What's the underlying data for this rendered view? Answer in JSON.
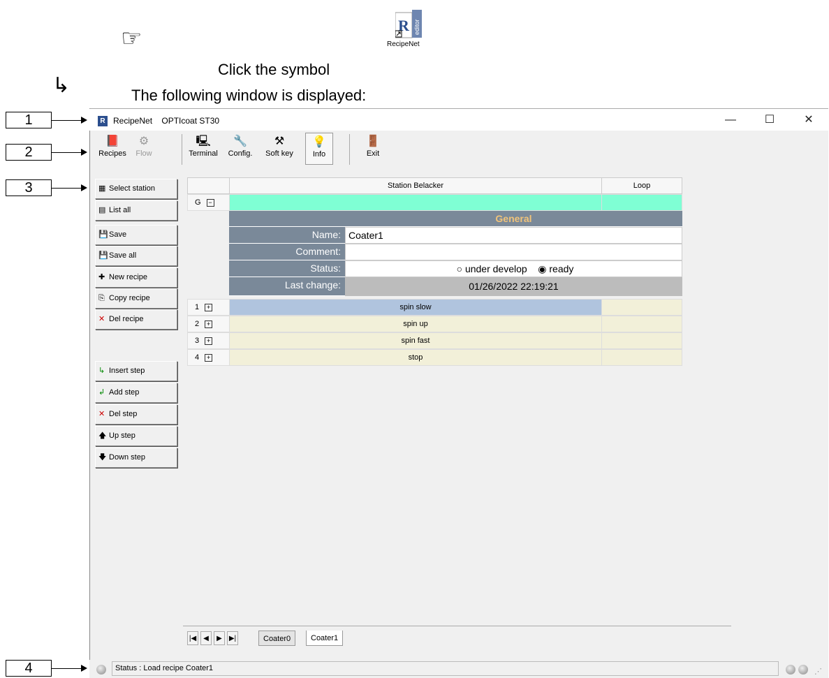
{
  "instructions": {
    "step_text": "Click the symbol",
    "app_icon_label": "RecipeNet",
    "result_text": "The following window is displayed:",
    "app_icon_tag": "editor"
  },
  "callouts": [
    "1",
    "2",
    "3",
    "4"
  ],
  "window": {
    "app_name": "RecipeNet",
    "subtitle": "OPTIcoat ST30",
    "logo_letter": "R",
    "minimize": "—",
    "maximize": "☐",
    "close": "✕"
  },
  "toolbar": [
    {
      "label": "Recipes",
      "icon": "book-icon",
      "glyph": "📕"
    },
    {
      "label": "Flow",
      "icon": "flow-icon",
      "glyph": "⚙"
    },
    {
      "label": "Terminal",
      "icon": "terminal-icon",
      "glyph": "🖳"
    },
    {
      "label": "Config.",
      "icon": "config-icon",
      "glyph": "🔧"
    },
    {
      "label": "Soft key",
      "icon": "softkey-icon",
      "glyph": "⚒"
    },
    {
      "label": "Info",
      "icon": "lightbulb-icon",
      "glyph": "💡"
    },
    {
      "label": "Exit",
      "icon": "exit-door-icon",
      "glyph": "🚪"
    }
  ],
  "side_buttons": [
    {
      "label": "Select station",
      "glyph": "▦"
    },
    {
      "label": "List all",
      "glyph": "▤"
    },
    {
      "label": "Save",
      "glyph": "💾"
    },
    {
      "label": "Save all",
      "glyph": "💾"
    },
    {
      "label": "New recipe",
      "glyph": "✚"
    },
    {
      "label": "Copy recipe",
      "glyph": "⎘"
    },
    {
      "label": "Del recipe",
      "glyph": "✕"
    },
    {
      "label": "Insert step",
      "glyph": "↳"
    },
    {
      "label": "Add step",
      "glyph": "↲"
    },
    {
      "label": "Del step",
      "glyph": "✕"
    },
    {
      "label": "Up step",
      "glyph": "🡅"
    },
    {
      "label": "Down step",
      "glyph": "🡇"
    }
  ],
  "grid": {
    "col_station": "Station Belacker",
    "col_loop": "Loop",
    "group_row": "G",
    "general_header": "General",
    "fields": {
      "name_label": "Name:",
      "name_value": "Coater1",
      "comment_label": "Comment:",
      "comment_value": "",
      "status_label": "Status:",
      "status_option1": "under develop",
      "status_option2": "ready",
      "status_selected": "ready",
      "last_change_label": "Last change:",
      "last_change_value": "01/26/2022 22:19:21"
    },
    "steps": [
      {
        "num": "1",
        "name": "spin slow"
      },
      {
        "num": "2",
        "name": "spin up"
      },
      {
        "num": "3",
        "name": "spin fast"
      },
      {
        "num": "4",
        "name": "stop"
      }
    ]
  },
  "nav": {
    "first": "|◀",
    "prev": "◀",
    "next": "▶",
    "last": "▶|"
  },
  "tabs": [
    "Coater0",
    "Coater1"
  ],
  "active_tab": "Coater1",
  "status": {
    "text": "Status : Load recipe Coater1"
  }
}
